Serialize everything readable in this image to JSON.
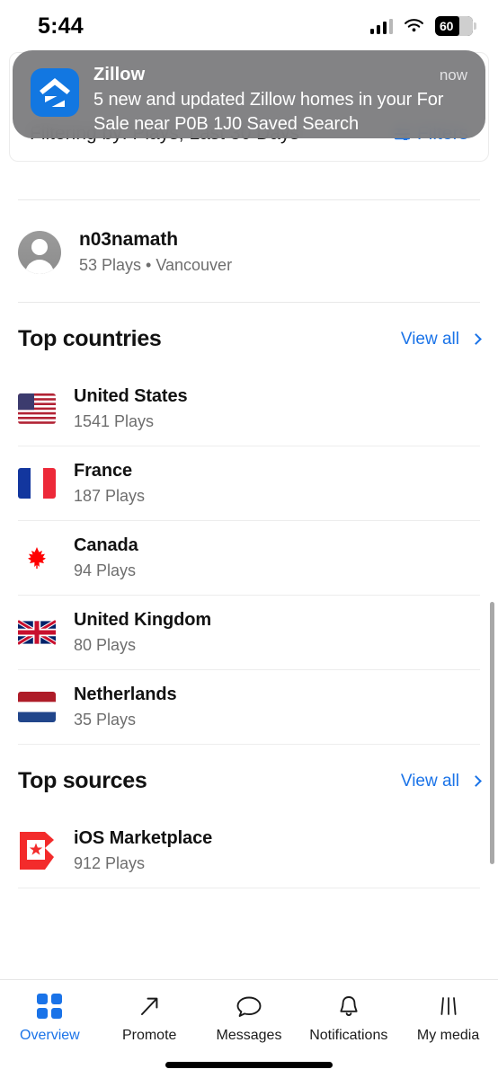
{
  "status_bar": {
    "time": "5:44",
    "battery_percent": "60",
    "icons": [
      "cellular-signal-icon",
      "wifi-icon",
      "battery-icon"
    ]
  },
  "notification": {
    "app_name": "Zillow",
    "time": "now",
    "message": "5 new and updated Zillow homes in your For Sale near P0B 1J0 Saved Search",
    "icon": "zillow-app-icon"
  },
  "filter_bar": {
    "text": "Filtering by: Plays, Last 30 Days",
    "filters_label": "Filters",
    "accent": "#1a73e8"
  },
  "profile": {
    "name": "n03namath",
    "subtitle": "53 Plays • Vancouver",
    "avatar": "default-avatar-icon"
  },
  "sections": [
    {
      "title": "Top countries",
      "view_all": "View all",
      "rows": [
        {
          "name": "United States",
          "sub": "1541 Plays",
          "flag": "flag-united-states"
        },
        {
          "name": "France",
          "sub": "187 Plays",
          "flag": "flag-france"
        },
        {
          "name": "Canada",
          "sub": "94 Plays",
          "flag": "flag-canada"
        },
        {
          "name": "United Kingdom",
          "sub": "80 Plays",
          "flag": "flag-united-kingdom"
        },
        {
          "name": "Netherlands",
          "sub": "35 Plays",
          "flag": "flag-netherlands"
        }
      ]
    },
    {
      "title": "Top sources",
      "view_all": "View all",
      "rows": [
        {
          "name": "iOS Marketplace",
          "sub": "912 Plays",
          "icon": "bandcamp-marketplace-icon"
        }
      ]
    }
  ],
  "tab_bar": {
    "active": "Overview",
    "tabs": [
      {
        "label": "Overview",
        "icon": "grid-icon"
      },
      {
        "label": "Promote",
        "icon": "arrow-up-right-icon"
      },
      {
        "label": "Messages",
        "icon": "speech-bubble-icon"
      },
      {
        "label": "Notifications",
        "icon": "bell-icon"
      },
      {
        "label": "My media",
        "icon": "media-lines-icon"
      }
    ]
  }
}
